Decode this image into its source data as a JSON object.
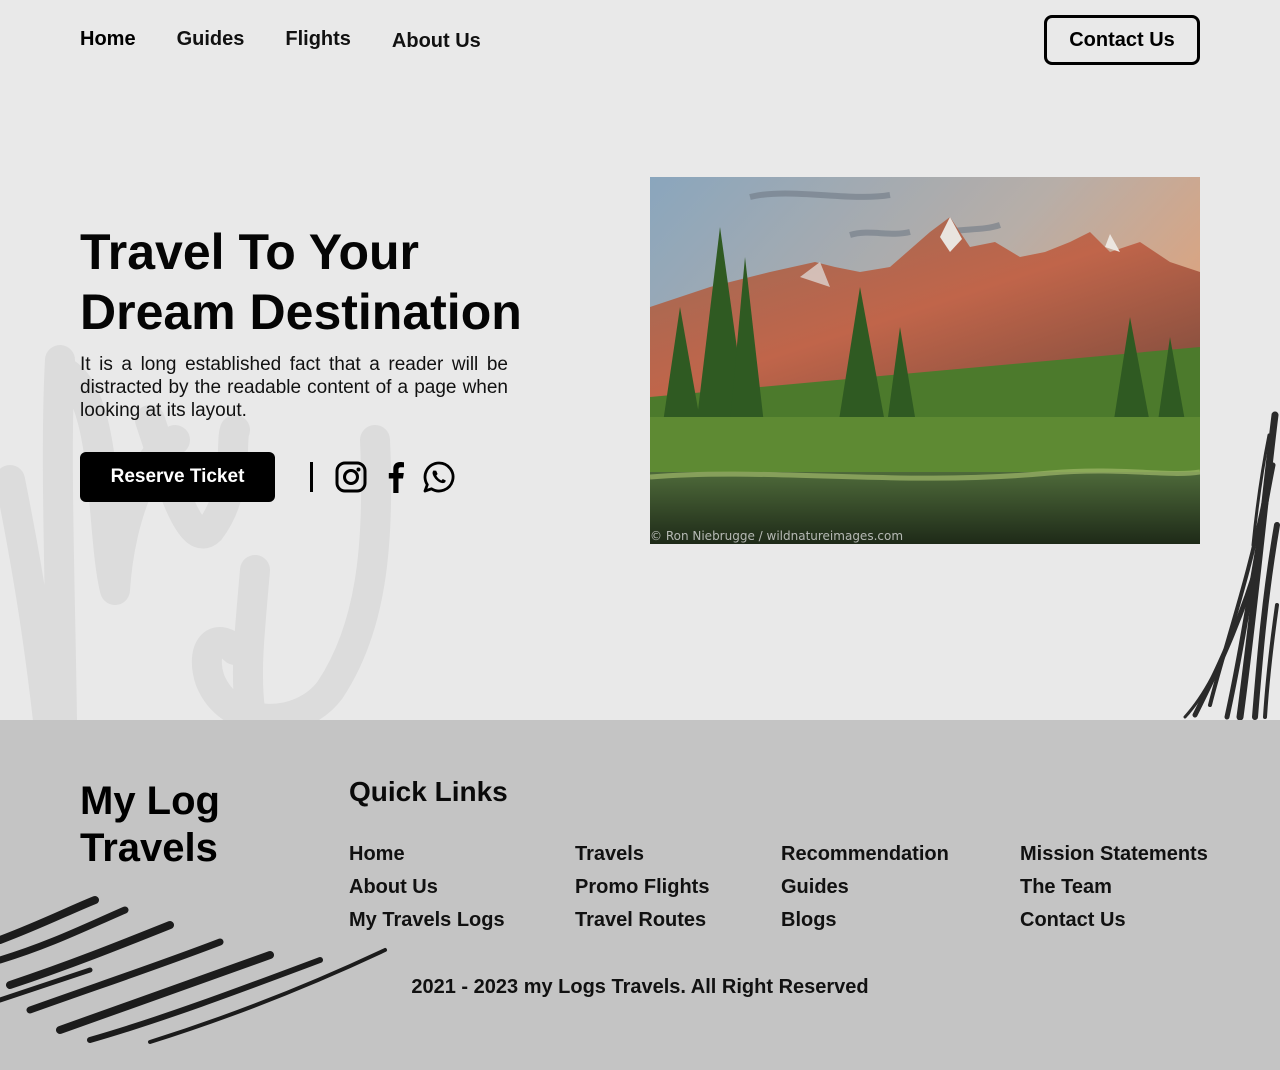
{
  "nav": {
    "items": [
      {
        "label": "Home",
        "active": true
      },
      {
        "label": "Guides"
      },
      {
        "label": "Flights"
      },
      {
        "label": "About Us"
      }
    ],
    "contact_label": "Contact Us"
  },
  "hero": {
    "title": "Travel To Your\nDream  Destination",
    "text": "It is a long established fact that a reader will be distracted by the readable content of a page when looking at its layout.",
    "reserve_label": "Reserve Ticket",
    "social_icons": [
      "instagram-icon",
      "facebook-icon",
      "whatsapp-icon"
    ],
    "image_credit": "© Ron Niebrugge / wildnatureimages.com"
  },
  "footer": {
    "brand": "My Log\nTravels",
    "quick_links_title": "Quick Links",
    "columns": [
      [
        "Home",
        "About Us",
        "My Travels Logs"
      ],
      [
        "Travels",
        "Promo Flights",
        "Travel Routes"
      ],
      [
        "Recommendation",
        "Guides",
        "Blogs"
      ],
      [
        "Mission Statements",
        "The Team",
        "Contact Us"
      ]
    ],
    "copyright": "2021 - 2023 my Logs Travels. All Right Reserved"
  },
  "colors": {
    "background": "#e9e9e9",
    "footer_background": "#c4c4c4",
    "primary": "#000000",
    "button_text": "#ffffff"
  }
}
